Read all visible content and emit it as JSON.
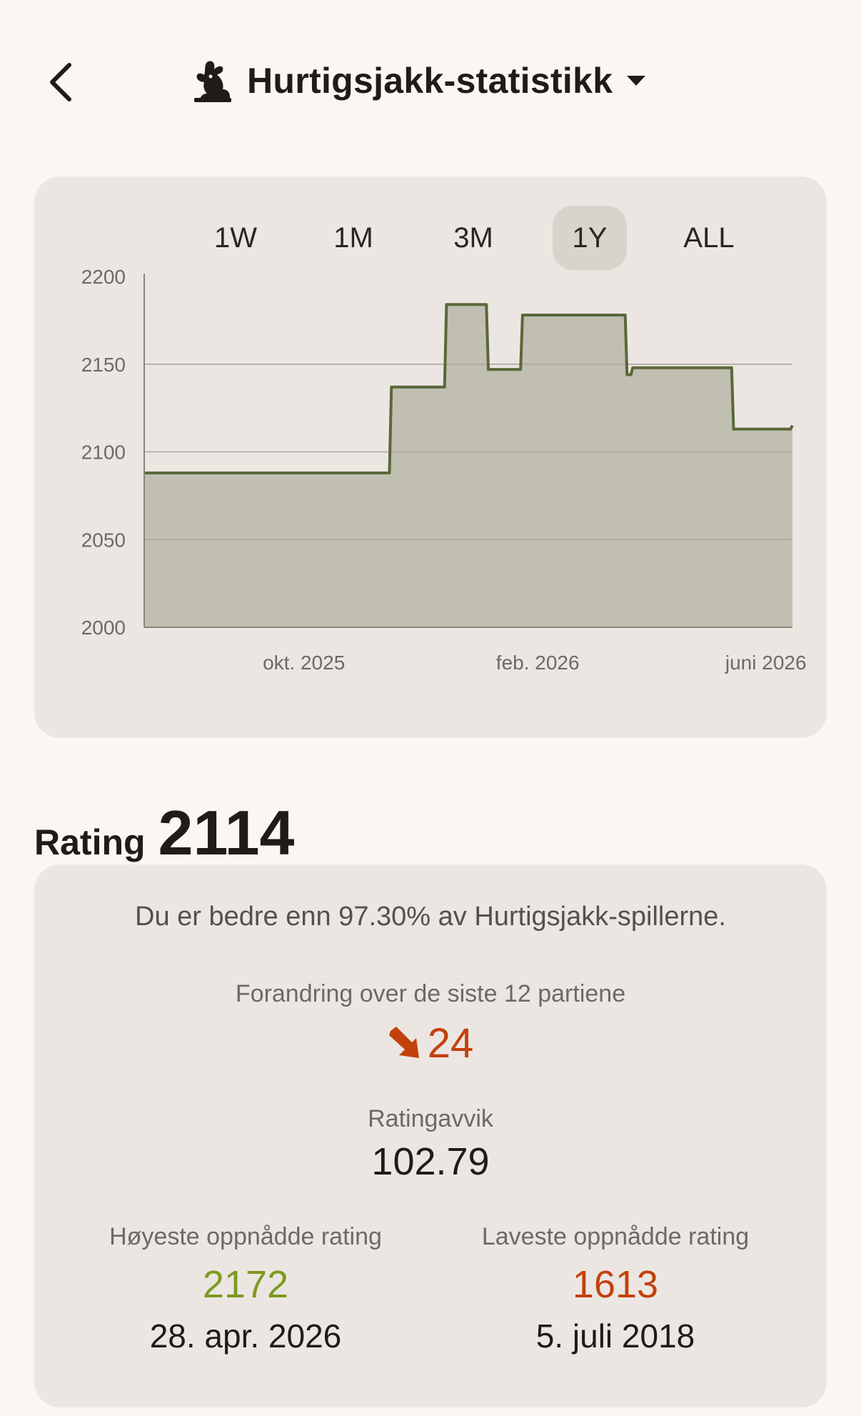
{
  "header": {
    "back_icon": "chevron-left-icon",
    "mode_icon": "rabbit-icon",
    "title": "Hurtigsjakk-statistikk",
    "dropdown_icon": "caret-down-icon"
  },
  "range_tabs": [
    "1W",
    "1M",
    "3M",
    "1Y",
    "ALL"
  ],
  "range_selected": "1Y",
  "chart_data": {
    "type": "area",
    "y_ticks": [
      "2200",
      "2150",
      "2100",
      "2050",
      "2000"
    ],
    "x_ticks": [
      "okt. 2025",
      "feb. 2026",
      "juni 2026"
    ],
    "ylim": [
      2000,
      2200
    ],
    "grid": true,
    "line_color": "#59683a",
    "fill_color": "#c1bfb1",
    "series": [
      {
        "values": [
          [
            "2025-07-09",
            2088
          ],
          [
            "2025-11-15",
            2088
          ],
          [
            "2025-11-16",
            2137
          ],
          [
            "2025-12-14",
            2137
          ],
          [
            "2025-12-15",
            2184
          ],
          [
            "2026-01-05",
            2184
          ],
          [
            "2026-01-06",
            2147
          ],
          [
            "2026-01-23",
            2147
          ],
          [
            "2026-01-24",
            2178
          ],
          [
            "2026-03-19",
            2178
          ],
          [
            "2026-03-20",
            2144
          ],
          [
            "2026-03-22",
            2144
          ],
          [
            "2026-03-23",
            2148
          ],
          [
            "2026-05-14",
            2148
          ],
          [
            "2026-05-15",
            2113
          ],
          [
            "2026-06-14",
            2113
          ],
          [
            "2026-06-15",
            2115
          ]
        ]
      }
    ]
  },
  "rating": {
    "label": "Rating",
    "value": "2114"
  },
  "stats": {
    "percentile_text": "Du er bedre enn 97.30% av Hurtigsjakk-spillerne.",
    "change_label": "Forandring over de siste 12 partiene",
    "change_icon": "arrow-down-right-icon",
    "change_value": "24",
    "change_color": "#c2410c",
    "deviation_label": "Ratingavvik",
    "deviation_value": "102.79",
    "highest_label": "Høyeste oppnådde rating",
    "highest_value": "2172",
    "highest_color": "#7d9a1f",
    "highest_date": "28. apr. 2026",
    "lowest_label": "Laveste oppnådde rating",
    "lowest_value": "1613",
    "lowest_color": "#c2410c",
    "lowest_date": "5. juli 2018"
  }
}
